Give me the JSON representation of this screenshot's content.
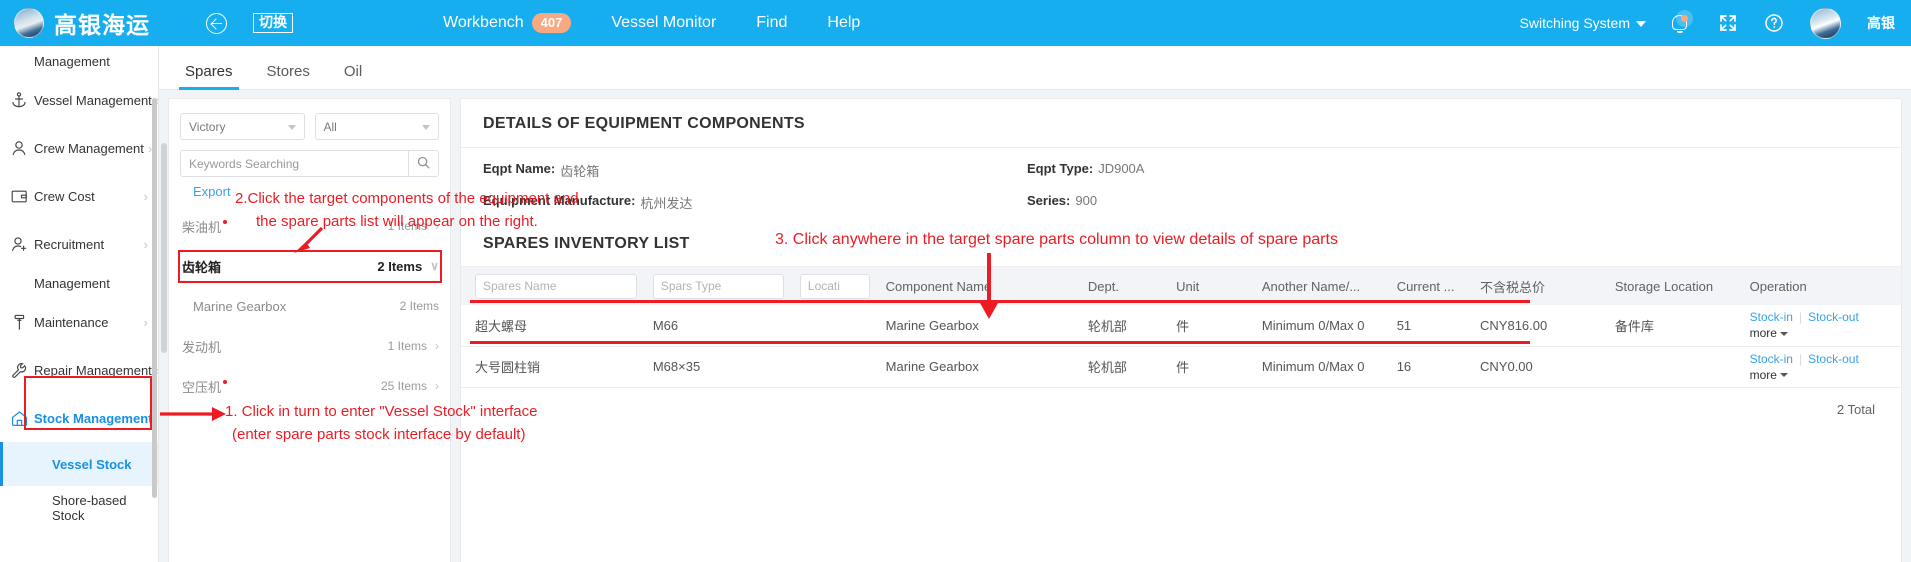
{
  "topbar": {
    "brand_name": "高银海运",
    "switch_label": "切换",
    "nav": [
      {
        "label": "Workbench",
        "badge": "407"
      },
      {
        "label": "Vessel Monitor",
        "badge": ""
      },
      {
        "label": "Find",
        "badge": ""
      },
      {
        "label": "Help",
        "badge": ""
      }
    ],
    "switching_system": "Switching System",
    "user_name": "高银",
    "icons": [
      "bell-icon",
      "fullscreen-icon",
      "help-icon",
      "avatar"
    ]
  },
  "sidebar": {
    "top_wrapped_label": "Management",
    "items": [
      {
        "label": "Vessel Management",
        "icon": "anchor-icon",
        "chevron": "›"
      },
      {
        "label": "Crew Management",
        "icon": "person-icon",
        "chevron": "›"
      },
      {
        "label": "Crew Cost",
        "icon": "wallet-icon",
        "chevron": "›"
      },
      {
        "label": "Recruitment",
        "icon": "person-add-icon",
        "chevron": "›",
        "wrap": "Management"
      },
      {
        "label": "Maintenance",
        "icon": "tool-icon",
        "chevron": "›"
      },
      {
        "label": "Repair Management",
        "icon": "wrench-icon",
        "chevron": "›"
      },
      {
        "label": "Stock Management",
        "icon": "home-icon",
        "chevron": "∨"
      }
    ],
    "sub_items": [
      {
        "label": "Vessel Stock",
        "active": true
      },
      {
        "label": "Shore-based Stock",
        "active": false
      }
    ]
  },
  "tabs": [
    {
      "label": "Spares",
      "active": true
    },
    {
      "label": "Stores",
      "active": false
    },
    {
      "label": "Oil",
      "active": false
    }
  ],
  "leftpane": {
    "vessel_select": "Victory",
    "type_select": "All",
    "search_placeholder": "Keywords Searching",
    "export_label": "Export",
    "search_icon": "magnifier-icon",
    "tree": [
      {
        "name": "柴油机",
        "dot": true,
        "count": "1 Items",
        "chevron": "›",
        "selected": false,
        "sub": false
      },
      {
        "name": "齿轮箱",
        "dot": false,
        "count": "2 Items",
        "chevron": "∨",
        "selected": true,
        "sub": false
      },
      {
        "name": "Marine Gearbox",
        "dot": false,
        "count": "2 Items",
        "chevron": "",
        "selected": false,
        "sub": true
      },
      {
        "name": "发动机",
        "dot": false,
        "count": "1 Items",
        "chevron": "›",
        "selected": false,
        "sub": false
      },
      {
        "name": "空压机",
        "dot": true,
        "count": "25 Items",
        "chevron": "›",
        "selected": false,
        "sub": false
      }
    ]
  },
  "details": {
    "title": "DETAILS OF EQUIPMENT COMPONENTS",
    "fields": [
      {
        "key": "Eqpt Name:",
        "value": "齿轮箱"
      },
      {
        "key": "Eqpt Type:",
        "value": "JD900A"
      },
      {
        "key": "Equipment Manufacture:",
        "value": "杭州发达"
      },
      {
        "key": "Series:",
        "value": "900"
      }
    ]
  },
  "inventory": {
    "title": "SPARES INVENTORY LIST",
    "filters": [
      {
        "placeholder": "Spares Name"
      },
      {
        "placeholder": "Spars Type"
      },
      {
        "placeholder": "Locati"
      }
    ],
    "columns": [
      "Spares Name",
      "Spars Type",
      "Locati",
      "Component Name",
      "Dept.",
      "Unit",
      "Another Name/...",
      "Current ...",
      "不含税总价",
      "Storage Location",
      "Operation"
    ],
    "rows": [
      {
        "spares_name": "超大螺母",
        "spars_type": "M66",
        "location": "",
        "component_name": "Marine Gearbox",
        "dept": "轮机部",
        "unit": "件",
        "another_name": "Minimum 0/Max 0",
        "current": "51",
        "price": "CNY816.00",
        "storage": "备件库",
        "op_stock_in": "Stock-in",
        "op_stock_out": "Stock-out",
        "op_more": "more"
      },
      {
        "spares_name": "大号圆柱销",
        "spars_type": "M68×35",
        "location": "",
        "component_name": "Marine Gearbox",
        "dept": "轮机部",
        "unit": "件",
        "another_name": "Minimum 0/Max 0",
        "current": "16",
        "price": "CNY0.00",
        "storage": "",
        "op_stock_in": "Stock-in",
        "op_stock_out": "Stock-out",
        "op_more": "more"
      }
    ],
    "total_label": "2 Total"
  },
  "annotations": {
    "step1_line1": "1. Click in turn to enter \"Vessel Stock\" interface",
    "step1_line2": "(enter spare parts stock interface by default)",
    "step2_line1": "2.Click the target components of the equipment and",
    "step2_line2": "the spare parts list will appear on the right.",
    "step3": "3. Click anywhere in the target spare parts column to view details of spare parts"
  },
  "colors": {
    "brand_blue": "#16AEEF",
    "accent_link": "#39a1e8",
    "annotation_red": "#ED1C24",
    "badge_orange": "#F9A982"
  }
}
